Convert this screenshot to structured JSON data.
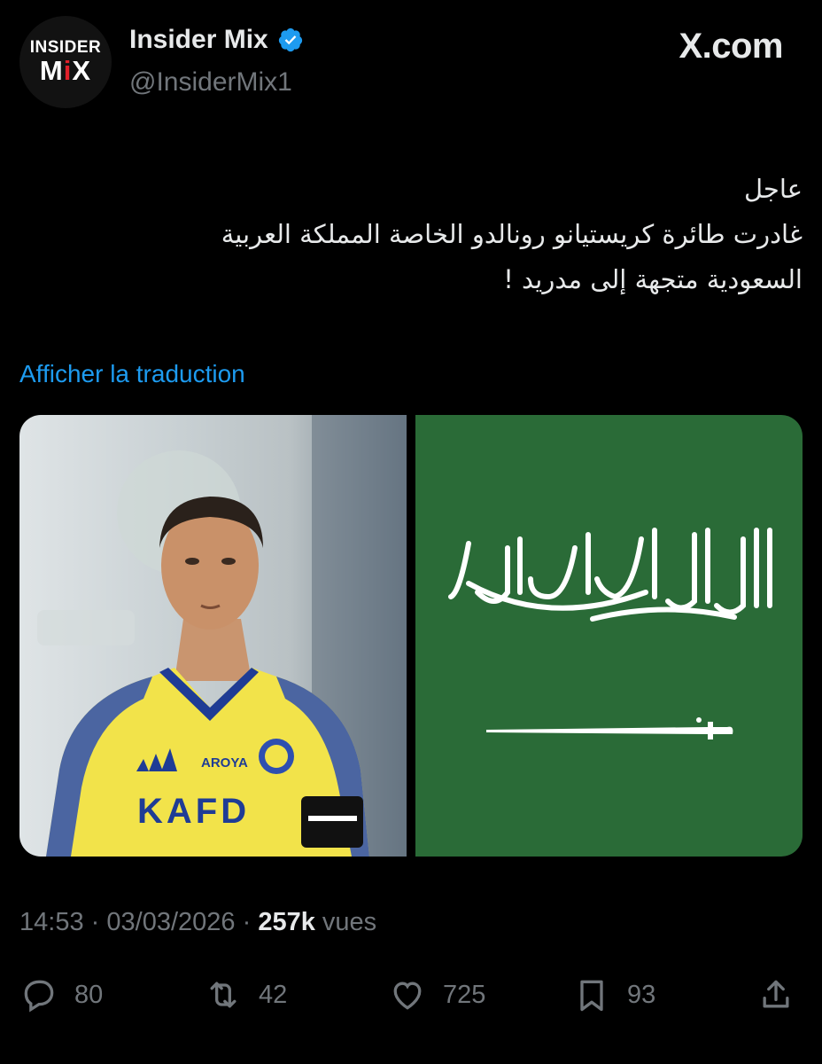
{
  "account": {
    "name": "Insider Mix",
    "handle": "@InsiderMix1",
    "avatar_line1": "INSIDER",
    "avatar_line2_a": "M",
    "avatar_line2_b": "i",
    "avatar_line2_c": "X"
  },
  "site": "X.com",
  "tweet": {
    "lines": [
      "عاجل",
      "غادرت طائرة كريستيانو رونالدو الخاصة المملكة العربية",
      "السعودية متجهة إلى مدريد !"
    ]
  },
  "translate_link": "Afficher la traduction",
  "media": {
    "left_image": "photo of a footballer in a yellow and blue jersey",
    "right_image": "green flag with white script and sword",
    "jersey_text": "KAFD",
    "sponsor_text": "AROYA"
  },
  "meta": {
    "time": "14:53",
    "sep1": "·",
    "date": "03/03/2026",
    "sep2": "·",
    "views": "257k",
    "views_label": "vues"
  },
  "actions": {
    "replies": "80",
    "reposts": "42",
    "likes": "725",
    "bookmarks": "93"
  },
  "colors": {
    "background": "#000000",
    "link": "#1d9bf0",
    "muted": "#71767b",
    "flag_green": "#2a6b37",
    "jersey_yellow": "#f2e34a"
  }
}
